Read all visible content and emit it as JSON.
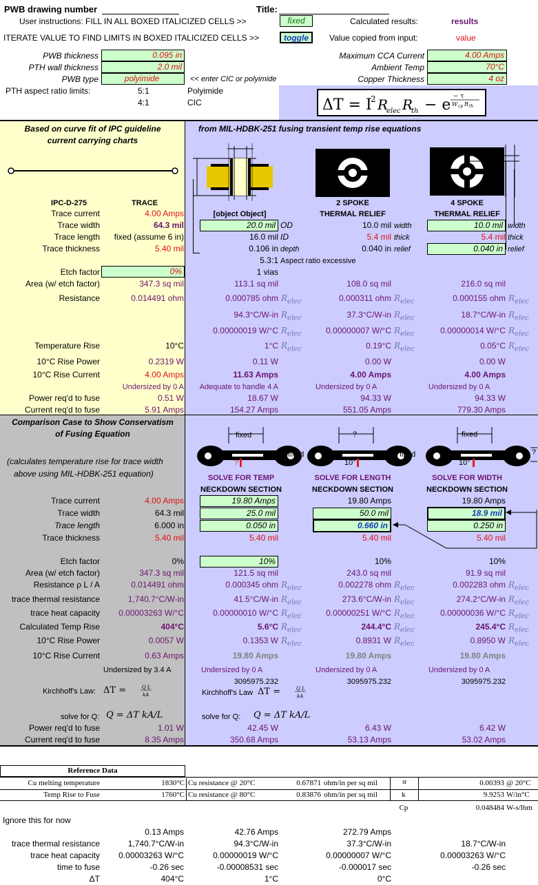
{
  "header": {
    "drawing_label": "PWB drawing number",
    "title_label": "Title:",
    "instr1": "User instructions: FILL IN ALL BOXED ITALICIZED CELLS >>",
    "fixed": "fixed",
    "calc_label": "Calculated results:",
    "results": "results",
    "instr2": "ITERATE VALUE TO FIND LIMITS IN BOXED ITALICIZED CELLS >>",
    "toggle": "toggle",
    "copied_label": "Value copied from input:",
    "value": "value"
  },
  "inputs": {
    "thk_label": "PWB thickness",
    "thk": "0.095 in",
    "pth_label": "PTH wall thickness",
    "pth": "2.0 mil",
    "type_label": "PWB type",
    "type": "polyimide",
    "type_hint": "<<  enter CIC or polyimide",
    "aspect_label": "PTH aspect ratio limits:",
    "r1": "5:1",
    "r1n": "Polyimide",
    "r2": "4:1",
    "r2n": "CIC",
    "maxcur_label": "Maximum CCA Current",
    "maxcur": "4.00 Amps",
    "amb_label": "Ambient Temp",
    "amb": "70°C",
    "cu_label": "Copper Thickness",
    "cu": "4 oz"
  },
  "sec1": {
    "left_title1": "Based on curve fit of IPC guideline",
    "left_title2": "current carrying charts",
    "right_title": "from MIL-HDBK-251 fusing transient temp rise equations",
    "ipc": "IPC-D-275",
    "trace": "TRACE",
    "via": {
      "od": "20.0 mil",
      "od_l": "OD",
      "id": "16.0 mil",
      "id_l": "ID",
      "depth": "0.106 in",
      "depth_l": "depth",
      "aspect": "5.3:1",
      "aspect_msg": "Aspect ratio excessive",
      "nvias": "1 vias",
      "area": "113.1 sq mil",
      "res": "0.000785 ohm",
      "th": "94.3°C/W-in",
      "hc": "0.00000019 W/°C",
      "trise": "1°C",
      "pow": "0.11 W",
      "cur": "11.63 Amps",
      "msg": "Adequate to handle 4 A",
      "pfuse": "18.67 W",
      "cfuse": "154.27 Amps"
    },
    "spoke2": "2 SPOKE",
    "spoke4": "4 SPOKE",
    "relief": "THERMAL RELIEF",
    "rows": {
      "cur": {
        "label": "Trace current",
        "v": "4.00 Amps"
      },
      "wid": {
        "label": "Trace width",
        "v": "64.3 mil"
      },
      "len": {
        "label": "Trace length",
        "v": "fixed (assume 6 in)"
      },
      "thk": {
        "label": "Trace thickness",
        "v": "5.40 mil"
      },
      "etch": {
        "label": "Etch factor",
        "v": "0%"
      },
      "area": {
        "label": "Area (w/ etch factor)",
        "v": "347.3 sq mil"
      },
      "res": {
        "label": "Resistance",
        "v": "0.014491 ohm"
      },
      "trise": {
        "label": "Temperature Rise",
        "v": "10°C"
      },
      "pow": {
        "label": "10°C Rise Power",
        "v": "0.2319 W"
      },
      "rcur": {
        "label": "10°C Rise Current",
        "v": "4.00 Amps"
      },
      "under": {
        "v": "Undersized by 0 A"
      },
      "pfuse": {
        "label": "Power req'd to fuse",
        "v": "0.51 W"
      },
      "cfuse": {
        "label": "Current req'd to fuse",
        "v": "5.91 Amps"
      }
    },
    "s2": {
      "width": "10.0 mil",
      "width_l": "width",
      "thick": "5.4 mil",
      "thick_l": "thick",
      "relief": "0.040 in",
      "relief_l": "relief",
      "area": "108.0 sq mil",
      "res": "0.000311 ohm",
      "th": "37.3°C/W-in",
      "hc": "0.00000007 W/°C",
      "trise": "0.19°C",
      "pow": "0.00 W",
      "cur": "4.00 Amps",
      "msg": "Undersized by 0 A",
      "pfuse": "94.33 W",
      "cfuse": "551.05 Amps"
    },
    "s4": {
      "width": "10.0 mil",
      "width_l": "width",
      "thick": "5.4 mil",
      "thick_l": "thick",
      "relief": "0.040 in",
      "relief_l": "relief",
      "area": "216.0 sq mil",
      "res": "0.000155 ohm",
      "th": "18.7°C/W-in",
      "hc": "0.00000014 W/°C",
      "trise": "0.05°C",
      "pow": "0.00 W",
      "cur": "4.00 Amps",
      "msg": "Undersized by 0 A",
      "pfuse": "94.33 W",
      "cfuse": "779.30 Amps"
    },
    "relec": "R"
  },
  "sec2": {
    "title1": "Comparison Case to Show Conservatism",
    "title2": "of Fusing Equation",
    "note1": "(calculates temperature rise for trace width",
    "note2": "above using MIL-HDBK-251 equation)",
    "fixed": "fixed",
    "q": "?",
    "t10": "10°",
    "solve": {
      "a": "SOLVE FOR TEMP",
      "b": "SOLVE FOR LENGTH",
      "c": "SOLVE FOR WIDTH",
      "neck": "NECKDOWN SECTION"
    },
    "labels": {
      "cur": "Trace current",
      "wid": "Trace width",
      "len": "Trace length",
      "thk": "Trace thickness",
      "etch": "Etch factor",
      "area": "Area (w/ etch factor)",
      "res": "Resistance  ρ L / A",
      "th": "trace thermal resistance",
      "hc": "trace heat capacity",
      "ct": "Calculated Temp Rise",
      "pow": "10°C Rise Power",
      "rc": "10°C Rise Current",
      "pf": "Power req'd to fuse",
      "cf": "Current req'd to fuse"
    },
    "left": {
      "cur": "4.00 Amps",
      "wid": "64.3 mil",
      "len": "6.000 in",
      "thk": "5.40 mil",
      "etch": "0%",
      "area": "347.3 sq mil",
      "res": "0.014491 ohm",
      "th": "1,740.7°C/W-in",
      "hc": "0.00003263 W/°C",
      "ct": "404°C",
      "pow": "0.0057 W",
      "rc": "0.63 Amps",
      "under": "Undersized by 3.4 A",
      "pf": "1.01 W",
      "cf": "8.35 Amps"
    },
    "ca": {
      "cur": "19.80 Amps",
      "wid": "25.0 mil",
      "len": "0.050 in",
      "thk": "5.40 mil",
      "etch": "10%",
      "area": "121.5 sq mil",
      "res": "0.000345 ohm",
      "th": "41.5°C/W-in",
      "hc": "0.00000010 W/°C",
      "ct": "5.6°C",
      "pow": "0.1353 W",
      "rc": "19.80 Amps",
      "under": "Undersized by 0 A",
      "num": "3095975.232",
      "pf": "42.45 W",
      "cf": "350.68 Amps"
    },
    "cb": {
      "cur": "19.80 Amps",
      "wid": "50.0 mil",
      "len": "0.660 in",
      "thk": "5.40 mil",
      "etch": "10%",
      "area": "243.0 sq mil",
      "res": "0.002278 ohm",
      "th": "273.6°C/W-in",
      "hc": "0.00000251 W/°C",
      "ct": "244.4°C",
      "pow": "0.8931 W",
      "rc": "19.80 Amps",
      "under": "Undersized by 0 A",
      "num": "3095975.232",
      "pf": "6.43 W",
      "cf": "53.13 Amps"
    },
    "cc": {
      "cur": "19.80 Amps",
      "wid": "18.9 mil",
      "len": "0.250 in",
      "thk": "5.40 mil",
      "etch": "10%",
      "area": "91.9 sq mil",
      "res": "0.002283 ohm",
      "th": "274.2°C/W-in",
      "hc": "0.00000036 W/°C",
      "ct": "245.4°C",
      "pow": "0.8950 W",
      "rc": "19.80 Amps",
      "under": "Undersized by 0 A",
      "num": "3095975.232",
      "pf": "6.42 W",
      "cf": "53.02 Amps"
    },
    "kirch": "Kirchhoff's Law:",
    "kirch2": "Kirchhoff's Law",
    "solveq": "solve for Q:"
  },
  "ref": {
    "title": "Reference Data",
    "r1": {
      "a": "Cu melting temperature",
      "b": "1830°C",
      "c": "Cu resistance @ 20°C",
      "d": "0.67871",
      "e": "ohm/in per sq mil",
      "f": "α",
      "g": "0.00393",
      "h": "@ 20°C"
    },
    "r2": {
      "a": "Temp Rise to Fuse",
      "b": "1760°C",
      "c": "Cu resistance @ 80°C",
      "d": "0.83876",
      "e": "ohm/in per sq mil",
      "f": "k",
      "g": "9.9253",
      "h": "W/in°C"
    },
    "r3": {
      "f": "Cp",
      "g": "0.048484",
      "h": "W-s/lbm"
    }
  },
  "ignore": {
    "title": "Ignore this for now",
    "amps": [
      "0.13 Amps",
      "42.76 Amps",
      "272.79 Amps"
    ],
    "th_label": "trace thermal resistance",
    "th": [
      "1,740.7°C/W-in",
      "94.3°C/W-in",
      "37.3°C/W-in",
      "18.7°C/W-in"
    ],
    "hc_label": "trace heat capacity",
    "hc": [
      "0.00003263 W/°C",
      "0.00000019 W/°C",
      "0.00000007 W/°C",
      "0.00003263 W/°C"
    ],
    "tf_label": "time to fuse",
    "tf": [
      "-0.26 sec",
      "-0.00008531 sec",
      "-0.000017 sec",
      "-0.26 sec"
    ],
    "dt_label": "ΔT",
    "dt": [
      "404°C",
      "1°C",
      "0°C"
    ]
  },
  "colors": {
    "green": "#ccffcc",
    "yellow": "#ffffcc",
    "lavender": "#ccccff",
    "gray": "#c0c0c0",
    "red": "#e01010",
    "purple": "#6a1470"
  }
}
